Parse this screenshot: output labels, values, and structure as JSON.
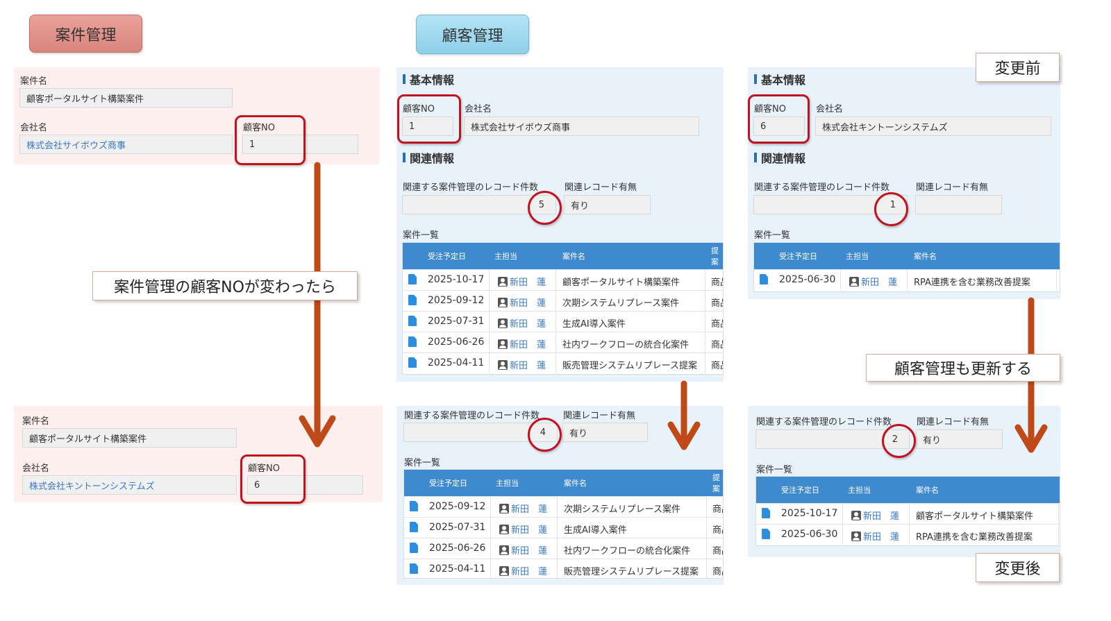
{
  "headers": {
    "left": "案件管理",
    "middle": "顧客管理"
  },
  "before_label": "変更前",
  "after_label": "変更後",
  "callouts": {
    "left": "案件管理の顧客NOが変わったら",
    "right": "顧客管理も更新する"
  },
  "case_before": {
    "case_name_label": "案件名",
    "case_name": "顧客ポータルサイト構築案件",
    "company_label": "会社名",
    "company": "株式会社サイボウズ商事",
    "customer_no_label": "顧客NO",
    "customer_no": "1"
  },
  "case_after": {
    "case_name_label": "案件名",
    "case_name": "顧客ポータルサイト構築案件",
    "company_label": "会社名",
    "company": "株式会社キントーンシステムズ",
    "customer_no_label": "顧客NO",
    "customer_no": "6"
  },
  "cust1": {
    "basic_title": "基本情報",
    "customer_no_label": "顧客NO",
    "customer_no": "1",
    "company_label": "会社名",
    "company": "株式会社サイボウズ商事",
    "related_title": "関連情報",
    "count_label": "関連する案件管理のレコード件数",
    "count_before": "5",
    "exists_label": "関連レコード有無",
    "exists_before": "有り",
    "list_label": "案件一覧",
    "count_after": "4",
    "exists_after": "有り"
  },
  "cust6": {
    "basic_title": "基本情報",
    "customer_no_label": "顧客NO",
    "customer_no": "6",
    "company_label": "会社名",
    "company": "株式会社キントーンシステムズ",
    "related_title": "関連情報",
    "count_label": "関連する案件管理のレコード件数",
    "count_before": "1",
    "exists_label": "関連レコード有無",
    "exists_before": "",
    "list_label": "案件一覧",
    "count_after": "2",
    "exists_after": "有り"
  },
  "table_headers": {
    "date": "受注予定日",
    "owner": "主担当",
    "name": "案件名",
    "extra": "提案"
  },
  "owner": "新田　蓮",
  "extra_cell": "商品",
  "cust1_rows_before": [
    {
      "date": "2025-10-17",
      "name": "顧客ポータルサイト構築案件"
    },
    {
      "date": "2025-09-12",
      "name": "次期システムリプレース案件"
    },
    {
      "date": "2025-07-31",
      "name": "生成AI導入案件"
    },
    {
      "date": "2025-06-26",
      "name": "社内ワークフローの統合化案件"
    },
    {
      "date": "2025-04-11",
      "name": "販売管理システムリプレース提案"
    }
  ],
  "cust1_rows_after": [
    {
      "date": "2025-09-12",
      "name": "次期システムリプレース案件"
    },
    {
      "date": "2025-07-31",
      "name": "生成AI導入案件"
    },
    {
      "date": "2025-06-26",
      "name": "社内ワークフローの統合化案件"
    },
    {
      "date": "2025-04-11",
      "name": "販売管理システムリプレース提案"
    }
  ],
  "cust6_rows_before": [
    {
      "date": "2025-06-30",
      "name": "RPA連携を含む業務改善提案"
    }
  ],
  "cust6_rows_after": [
    {
      "date": "2025-10-17",
      "name": "顧客ポータルサイト構築案件"
    },
    {
      "date": "2025-06-30",
      "name": "RPA連携を含む業務改善提案"
    }
  ],
  "colors": {
    "accent_red": "#c1121f",
    "arrow": "#bf4a17",
    "table_header": "#3f89cf",
    "link": "#3a78c2"
  }
}
